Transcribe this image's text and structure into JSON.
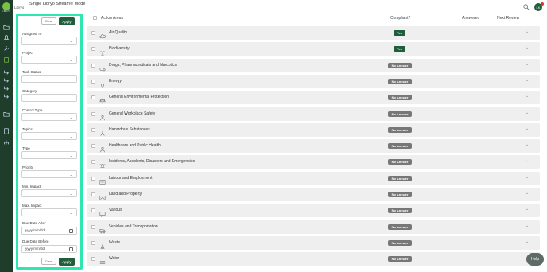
{
  "app": {
    "brand": "Libryo",
    "logo_text": "LIBRYO",
    "title": "Single Libryo Stream® Mode"
  },
  "filters": {
    "clear_label": "Clear",
    "apply_label": "Apply",
    "fields": [
      {
        "label": "Assigned To"
      },
      {
        "label": "Project"
      },
      {
        "label": "Task Status"
      },
      {
        "label": "Category"
      },
      {
        "label": "Control Type"
      },
      {
        "label": "Topics"
      },
      {
        "label": "Type"
      },
      {
        "label": "Priority"
      },
      {
        "label": "Min. Impact"
      },
      {
        "label": "Max. Impact"
      }
    ],
    "due_after": {
      "label": "Due Date After",
      "placeholder": "yyyy/mm/dd"
    },
    "due_before": {
      "label": "Due Date Before",
      "placeholder": "yyyy/mm/dd"
    }
  },
  "table": {
    "headers": {
      "action_areas": "Action Areas",
      "compliant": "Compliant?",
      "answered": "Answered",
      "next_review": "Next Review"
    },
    "rows": [
      {
        "name": "Air Quality",
        "status": "Yes",
        "icon": "cloud-icon"
      },
      {
        "name": "Biodiversity",
        "status": "Yes",
        "icon": "plant-icon"
      },
      {
        "name": "Drugs, Pharmaceuticals and Narcotics",
        "status": "No Answer",
        "icon": "pills-icon"
      },
      {
        "name": "Energy",
        "status": "No Answer",
        "icon": "bulb-icon"
      },
      {
        "name": "General Environmental Protection",
        "status": "No Answer",
        "icon": "scales-icon"
      },
      {
        "name": "General Workplace Safety",
        "status": "No Answer",
        "icon": "worker-icon"
      },
      {
        "name": "Hazardous Substances",
        "status": "No Answer",
        "icon": "hazard-icon"
      },
      {
        "name": "Healthcare and Public Health",
        "status": "No Answer",
        "icon": "health-icon"
      },
      {
        "name": "Incidents, Accidents, Disasters and Emergencies",
        "status": "No Answer",
        "icon": "siren-icon"
      },
      {
        "name": "Labour and Employment",
        "status": "No Answer",
        "icon": "id-card-icon"
      },
      {
        "name": "Land and Property",
        "status": "No Answer",
        "icon": "map-icon"
      },
      {
        "name": "Various",
        "status": "No Answer",
        "icon": "chat-icon"
      },
      {
        "name": "Vehicles and Transportation",
        "status": "No Answer",
        "icon": "truck-icon"
      },
      {
        "name": "Waste",
        "status": "No Answer",
        "icon": "recycle-icon"
      },
      {
        "name": "Water",
        "status": "No Answer",
        "icon": "waves-icon"
      }
    ]
  },
  "user": {
    "initials": "LK"
  },
  "help_label": "Help",
  "colors": {
    "accent": "#1e5e3a",
    "highlight": "#2ee6b0",
    "rail": "#1f3d2b",
    "no_answer": "#777777"
  }
}
